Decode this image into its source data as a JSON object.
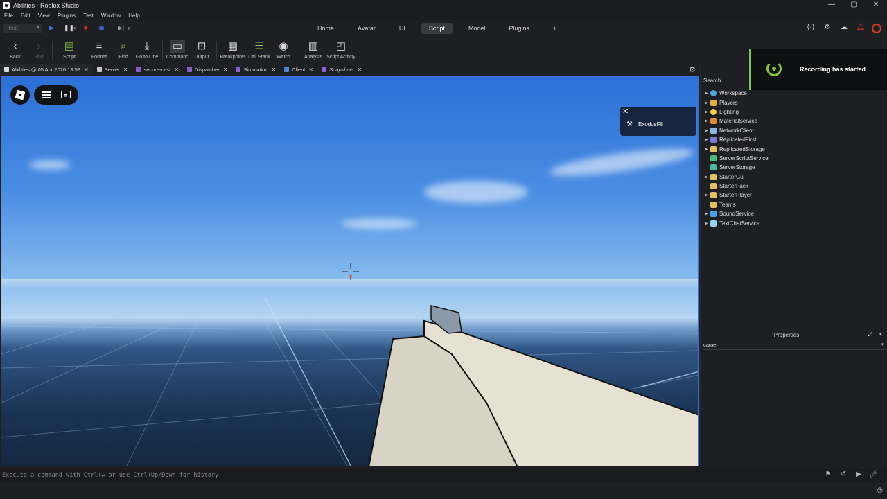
{
  "window": {
    "title": "Abilities - Roblox Studio",
    "controls": [
      "—",
      "▢",
      "✕"
    ]
  },
  "menu": [
    "File",
    "Edit",
    "View",
    "Plugins",
    "Test",
    "Window",
    "Help"
  ],
  "modebar": {
    "test_select": "Test",
    "tabs": [
      "Home",
      "Avatar",
      "UI",
      "Script",
      "Model",
      "Plugins"
    ],
    "active_tab": "Script",
    "add_tab": "+"
  },
  "toolbar": {
    "back": "Back",
    "find_disabled": "Find",
    "script": "Script",
    "format": "Format",
    "find": "Find",
    "go_to_line": "Go to Line",
    "command": "Command",
    "output": "Output",
    "breakpoints": "Breakpoints",
    "call_stack": "Call Stack",
    "watch": "Watch",
    "analysis": "Analysis",
    "script_activity": "Script Activity"
  },
  "doc_tabs": [
    {
      "label": "Abilities @ 05 Apr 2026 13:58",
      "color": "#d9d9d9"
    },
    {
      "label": "Server",
      "color": "#c9c9c9"
    },
    {
      "label": "secure-cast",
      "color": "#8a5fd0"
    },
    {
      "label": "Dispatcher",
      "color": "#8a5fd0"
    },
    {
      "label": "Simulation",
      "color": "#8a5fd0"
    },
    {
      "label": "Client",
      "color": "#4a8ad8"
    },
    {
      "label": "Snapshots",
      "color": "#8a5fd0"
    }
  ],
  "viewport": {
    "player_name": "ExodusF8"
  },
  "toast": {
    "text": "Recording has started",
    "accent": "#84c43b"
  },
  "explorer": {
    "search_label": "Search",
    "items": [
      {
        "label": "Workspace",
        "icon_color": "#4aa3e0",
        "expandable": true
      },
      {
        "label": "Players",
        "icon_color": "#e0b13a",
        "expandable": true
      },
      {
        "label": "Lighting",
        "icon_color": "#f3d24a",
        "expandable": true
      },
      {
        "label": "MaterialService",
        "icon_color": "#e08a3a",
        "expandable": true
      },
      {
        "label": "NetworkClient",
        "icon_color": "#8fb8e0",
        "expandable": true
      },
      {
        "label": "ReplicatedFirst",
        "icon_color": "#7a7ad8",
        "expandable": true
      },
      {
        "label": "ReplicatedStorage",
        "icon_color": "#e0c060",
        "expandable": true
      },
      {
        "label": "ServerScriptService",
        "icon_color": "#4ab87a",
        "expandable": false
      },
      {
        "label": "ServerStorage",
        "icon_color": "#4ab8a0",
        "expandable": false
      },
      {
        "label": "StarterGui",
        "icon_color": "#e0c060",
        "expandable": true
      },
      {
        "label": "StarterPack",
        "icon_color": "#e0c060",
        "expandable": false
      },
      {
        "label": "StarterPlayer",
        "icon_color": "#e0c060",
        "expandable": true
      },
      {
        "label": "Teams",
        "icon_color": "#e0c060",
        "expandable": false
      },
      {
        "label": "SoundService",
        "icon_color": "#4aa3e0",
        "expandable": true
      },
      {
        "label": "TextChatService",
        "icon_color": "#9ad0f0",
        "expandable": true
      }
    ]
  },
  "properties": {
    "title": "Properties",
    "filter_value": "camer"
  },
  "command_bar": {
    "placeholder": "Execute a command with Ctrl+↵ or use Ctrl+Up/Down for history"
  }
}
